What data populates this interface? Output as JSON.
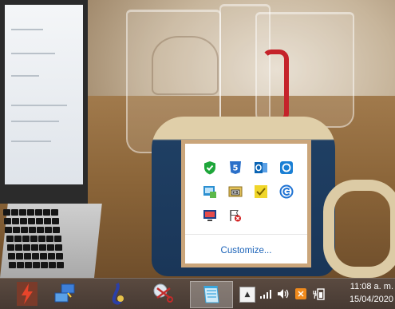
{
  "background": {
    "description_colors": {
      "table": "#8a6438",
      "mug": "#1f3f63",
      "mug_rim": "#e0cfa9",
      "red_logo": "#c5232a"
    }
  },
  "tray_popup": {
    "icons": [
      {
        "name": "security-shield-icon",
        "color": "#1ea63a"
      },
      {
        "name": "html5-icon",
        "color": "#2a6fc9"
      },
      {
        "name": "outlook-icon",
        "color": "#0a64b4"
      },
      {
        "name": "sync-icon",
        "color": "#1a7fd4"
      },
      {
        "name": "network-monitor-icon",
        "color": "#2b8fd1"
      },
      {
        "name": "keyboard-layout-icon",
        "color": "#444444"
      },
      {
        "name": "sticky-note-icon",
        "color": "#f0d62a"
      },
      {
        "name": "chrome-remote-icon",
        "color": "#1f73d3"
      },
      {
        "name": "display-icon",
        "color": "#1b3f8a"
      },
      {
        "name": "flag-error-icon",
        "color": "#d21c1c"
      }
    ],
    "customize_label": "Customize..."
  },
  "taskbar": {
    "apps": [
      {
        "name": "lightning-app-icon",
        "color": "#e8442a",
        "active": false
      },
      {
        "name": "network-app-icon",
        "color": "#3d7fd9",
        "active": false
      },
      {
        "name": "saxophone-app-icon",
        "color": "#2b3fa8",
        "active": false
      },
      {
        "name": "scissors-app-icon",
        "color": "#c22b2b",
        "active": false
      },
      {
        "name": "notepad-app-icon",
        "color": "#3aa7de",
        "active": true
      }
    ],
    "tray": {
      "show_hidden_glyph": "▲",
      "network_icon": "signal-bars-icon",
      "volume_icon": "speaker-icon",
      "app_icon": "orange-tray-icon",
      "power_icon": "battery-plug-icon"
    },
    "clock": {
      "time": "11:08 a. m.",
      "date": "15/04/2020"
    }
  }
}
